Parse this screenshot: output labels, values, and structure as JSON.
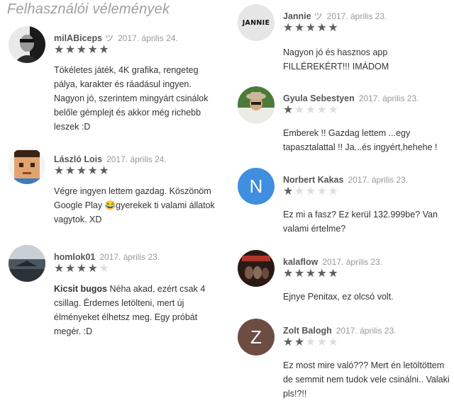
{
  "title": "Felhasználói vélemények",
  "reviews": [
    {
      "author": "milABiceps",
      "badge": "ツ",
      "date": "2017. április 24.",
      "rating": 5,
      "bold": "",
      "text": "Tökéletes játék, 4K grafika, rengeteg pálya, karakter és ráadásul ingyen. Nagyon jó, szerintem mingyárt csinálok belőle gémplejt és akkor még richebb leszek :D",
      "avatar": "photo-man"
    },
    {
      "author": "László Lois",
      "badge": "",
      "date": "2017. április 24.",
      "rating": 5,
      "bold": "",
      "text": "Végre ingyen lettem gazdag. Köszönöm Google Play 😂gyerekek ti valami állatok vagytok. XD",
      "avatar": "pixel-face"
    },
    {
      "author": "homlok01",
      "badge": "",
      "date": "2017. április 23.",
      "rating": 4,
      "bold": "Kicsit bugos",
      "text": "Néha akad, ezért csak 4 csillag. Érdemes letölteni, mert új élményeket élhetsz meg. Egy próbát megér. :D",
      "avatar": "photo-landscape"
    },
    {
      "author": "Jannie",
      "badge": "ツ",
      "date": "2017. április 23.",
      "rating": 5,
      "bold": "",
      "text": "Nagyon jó és hasznos app FILLÉREKÉRT!!! IMÁDOM",
      "avatar": "jannie-logo",
      "avatar_text": "JANNIE"
    },
    {
      "author": "Gyula Sebestyen",
      "badge": "",
      "date": "2017. április 23.",
      "rating": 1,
      "bold": "",
      "text": "Emberek !! Gazdag lettem ...egy tapasztalattal !! Ja...és ingyért,hehehe !",
      "avatar": "photo-hat"
    },
    {
      "author": "Norbert Kakas",
      "badge": "",
      "date": "2017. április 23.",
      "rating": 1,
      "bold": "",
      "text": "Ez mi a fasz? Ez kerül 132.999be? Van valami értelme?",
      "avatar": "letter",
      "avatar_text": "N",
      "avatar_color": "#3f8ee0"
    },
    {
      "author": "kalaflow",
      "badge": "",
      "date": "2017. április 23.",
      "rating": 5,
      "bold": "",
      "text": "Ejnye Penitax, ez olcsó volt.",
      "avatar": "photo-band"
    },
    {
      "author": "Zolt Balogh",
      "badge": "",
      "date": "2017. április 23.",
      "rating": 2,
      "bold": "",
      "text": "Ez most mire való??? Mert én letöltöttem de semmit nem tudok vele csinálni.. Valaki pls!?!!",
      "avatar": "letter",
      "avatar_text": "Z",
      "avatar_color": "#6d4c41"
    }
  ]
}
